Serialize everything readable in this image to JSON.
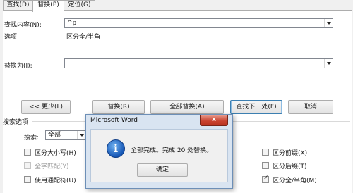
{
  "tabs": [
    {
      "label": "查找(D)",
      "active": false
    },
    {
      "label": "替换(P)",
      "active": true
    },
    {
      "label": "定位(G)",
      "active": false
    }
  ],
  "find": {
    "label": "查找内容(N):",
    "value": "^p"
  },
  "options": {
    "label": "选项:",
    "value": "区分全/半角"
  },
  "replace": {
    "label": "替换为(I):",
    "value": ""
  },
  "buttons": {
    "less": "<< 更少(L)",
    "replace": "替换(R)",
    "replace_all": "全部替换(A)",
    "find_next": "查找下一处(F)",
    "cancel": "取消"
  },
  "search_options": {
    "heading": "搜索选项",
    "search_label": "搜索:",
    "search_value": "全部",
    "checkboxes_left": [
      {
        "label": "区分大小写(H)",
        "checked": false,
        "disabled": false
      },
      {
        "label": "全字匹配(Y)",
        "checked": false,
        "disabled": true
      },
      {
        "label": "使用通配符(U)",
        "checked": false,
        "disabled": false
      }
    ],
    "checkboxes_right": [
      {
        "label": "区分前缀(X)",
        "checked": false,
        "disabled": false
      },
      {
        "label": "区分后缀(T)",
        "checked": false,
        "disabled": false
      },
      {
        "label": "区分全/半角(M)",
        "checked": true,
        "disabled": false
      }
    ]
  },
  "message_box": {
    "title": "Microsoft Word",
    "close": "x",
    "icon_glyph": "i",
    "text": "全部完成。完成 20 处替换。",
    "ok": "确定"
  },
  "colors": {
    "accent": "#3c7fb1",
    "close_button": "#c8412e",
    "dialog_frame": "#d9e4f1"
  }
}
